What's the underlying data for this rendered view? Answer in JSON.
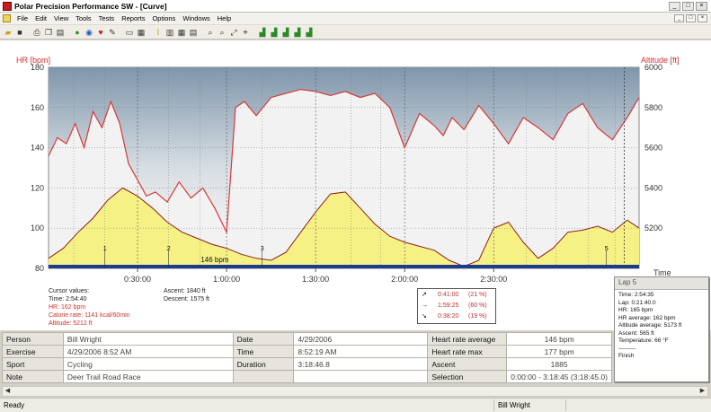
{
  "window": {
    "title": "Polar Precision Performance SW - [Curve]"
  },
  "menu": [
    "File",
    "Edit",
    "View",
    "Tools",
    "Tests",
    "Reports",
    "Options",
    "Windows",
    "Help"
  ],
  "chart_data": {
    "type": "line",
    "x_axis": {
      "ticks": [
        "0:30:00",
        "1:00:00",
        "1:30:00",
        "2:00:00",
        "2:30:00"
      ]
    },
    "y_left": {
      "label": "HR [bpm]",
      "ticks": [
        80,
        100,
        120,
        140,
        160,
        180
      ],
      "range": [
        80,
        180
      ]
    },
    "y_right": {
      "label": "Altitude [ft]",
      "ticks": [
        5200,
        5400,
        5600,
        5800,
        6000
      ],
      "range": [
        5000,
        6000
      ]
    },
    "right_bottom_label": "Time",
    "average_label": "146 bpm",
    "lap_markers": [
      "1",
      "2",
      "3",
      "5"
    ],
    "series": [
      {
        "name": "HR",
        "color": "#d43a3a"
      },
      {
        "name": "Altitude",
        "color": "#f5f184"
      }
    ],
    "hr_x": [
      0,
      3,
      6,
      9,
      12,
      15,
      18,
      21,
      24,
      27,
      30,
      33,
      36,
      40,
      44,
      48,
      52,
      56,
      60,
      63,
      66,
      70,
      75,
      80,
      85,
      90,
      95,
      100,
      105,
      110,
      115,
      120,
      125,
      130,
      133,
      136,
      140,
      145,
      150,
      155,
      160,
      165,
      170,
      175,
      180,
      185,
      190,
      195,
      199
    ],
    "hr_y": [
      136,
      145,
      142,
      152,
      140,
      158,
      150,
      163,
      152,
      132,
      124,
      116,
      118,
      113,
      123,
      115,
      120,
      110,
      98,
      160,
      163,
      156,
      165,
      167,
      169,
      168,
      166,
      168,
      165,
      167,
      160,
      140,
      157,
      151,
      146,
      155,
      149,
      161,
      152,
      142,
      155,
      150,
      144,
      157,
      162,
      150,
      144,
      155,
      165
    ],
    "alt_x": [
      0,
      5,
      10,
      15,
      20,
      25,
      30,
      35,
      40,
      45,
      50,
      55,
      60,
      65,
      70,
      75,
      80,
      85,
      90,
      95,
      100,
      105,
      110,
      115,
      120,
      125,
      130,
      135,
      140,
      145,
      150,
      155,
      160,
      165,
      170,
      175,
      180,
      185,
      190,
      195,
      199
    ],
    "alt_y": [
      5050,
      5100,
      5180,
      5250,
      5340,
      5400,
      5360,
      5300,
      5230,
      5180,
      5150,
      5120,
      5100,
      5070,
      5050,
      5040,
      5080,
      5180,
      5280,
      5370,
      5380,
      5300,
      5220,
      5160,
      5130,
      5110,
      5090,
      5040,
      5010,
      5040,
      5200,
      5230,
      5130,
      5050,
      5100,
      5180,
      5190,
      5210,
      5180,
      5240,
      5200
    ]
  },
  "cursor": {
    "title": "Cursor values:",
    "time": "Time: 2:54:40",
    "hr": "HR: 162 bpm",
    "calorie": "Calorie rate: 1141 kcal/60min",
    "altitude": "Altitude: 5212 ft"
  },
  "ascent": {
    "ascent": "Ascent: 1840 ft",
    "descent": "Descent: 1575 ft"
  },
  "zones": [
    {
      "arrow": "↗",
      "time": "0:41:00",
      "pct": "(21 %)"
    },
    {
      "arrow": "→",
      "time": "1:59:25",
      "pct": "(60 %)"
    },
    {
      "arrow": "↘",
      "time": "0:38:20",
      "pct": "(19 %)"
    }
  ],
  "lap": {
    "title": "Lap 5",
    "lines": [
      "Time: 2:54:35",
      "Lap: 0:21:40.0",
      "HR: 165 bpm",
      "HR average: 162 bpm",
      "Altitude average: 5173 ft",
      "Ascent: 565 ft",
      "Temperature: 66 °F",
      "---------",
      "Finish"
    ]
  },
  "info": {
    "rows": [
      [
        "Person",
        "Bill Wright",
        "Date",
        "4/29/2006",
        "Heart rate average",
        "146 bpm"
      ],
      [
        "Exercise",
        "4/29/2006 8:52 AM",
        "Time",
        "8:52:19 AM",
        "Heart rate max",
        "177 bpm"
      ],
      [
        "Sport",
        "Cycling",
        "Duration",
        "3:18:46.8",
        "Ascent",
        "1885"
      ],
      [
        "Note",
        "Deer Trail Road Race",
        "",
        "",
        "Selection",
        "0:00:00 - 3:18:45 (3:18:45.0)"
      ]
    ]
  },
  "status": {
    "left": "Ready",
    "user": "Bill Wright"
  }
}
